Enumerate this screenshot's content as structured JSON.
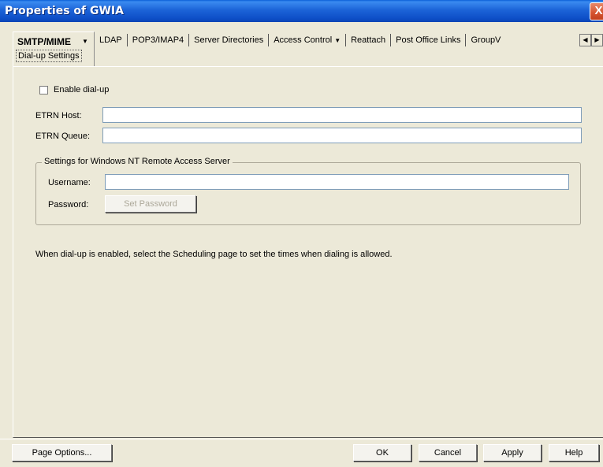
{
  "window": {
    "title": "Properties of GWIA",
    "close_glyph": "X"
  },
  "tabs": {
    "active": {
      "label": "SMTP/MIME",
      "sub_label": "Dial-up Settings"
    },
    "others": [
      {
        "label": "LDAP",
        "dropdown": false
      },
      {
        "label": "POP3/IMAP4",
        "dropdown": false
      },
      {
        "label": "Server Directories",
        "dropdown": false
      },
      {
        "label": "Access Control",
        "dropdown": true
      },
      {
        "label": "Reattach",
        "dropdown": false
      },
      {
        "label": "Post Office Links",
        "dropdown": false
      },
      {
        "label": "GroupV",
        "dropdown": false
      }
    ],
    "scroll_left": "◀",
    "scroll_right": "▶"
  },
  "form": {
    "enable_dialup_label": "Enable dial-up",
    "enable_dialup_checked": false,
    "etrn_host_label": "ETRN Host:",
    "etrn_host_value": "",
    "etrn_queue_label": "ETRN Queue:",
    "etrn_queue_value": "",
    "group_title": "Settings for Windows NT Remote Access Server",
    "username_label": "Username:",
    "username_value": "",
    "password_label": "Password:",
    "set_password_label": "Set Password",
    "info_text": "When dial-up is enabled, select the Scheduling page to set the times when dialing is allowed."
  },
  "footer": {
    "page_options": "Page Options...",
    "ok": "OK",
    "cancel": "Cancel",
    "apply": "Apply",
    "help": "Help"
  }
}
